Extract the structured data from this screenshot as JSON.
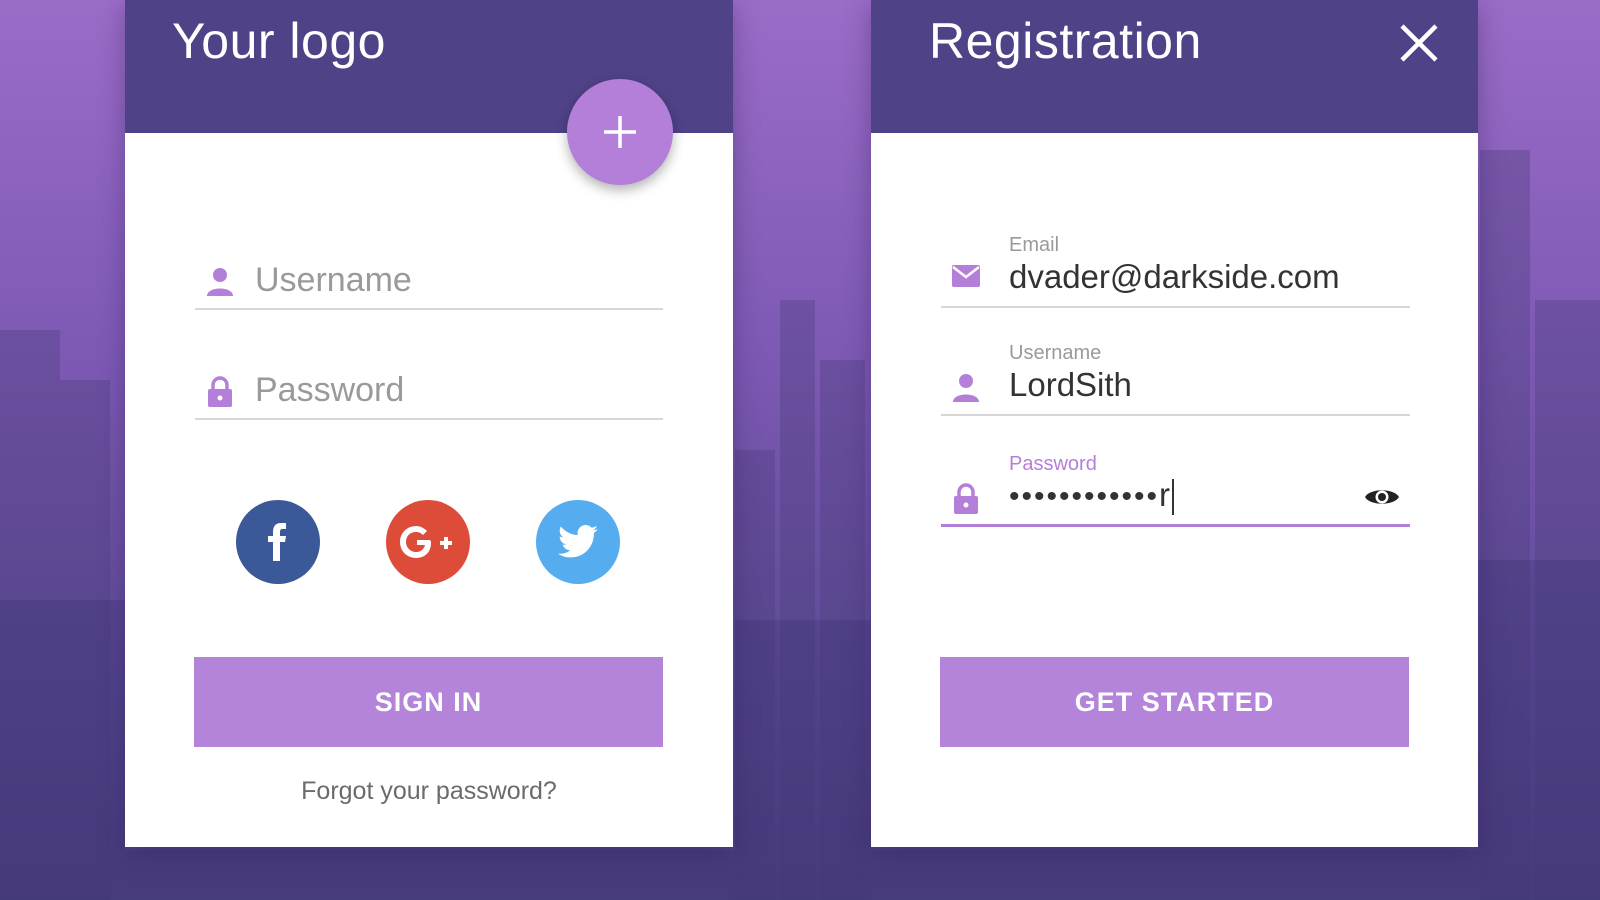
{
  "colors": {
    "header": "#4f4287",
    "accent": "#b47fd8",
    "facebook": "#3b5998",
    "google": "#dd4b39",
    "twitter": "#55acee"
  },
  "login_card": {
    "title": "Your logo",
    "fab_icon": "plus-icon",
    "username_placeholder": "Username",
    "password_placeholder": "Password",
    "social": [
      {
        "name": "facebook",
        "icon": "facebook-icon"
      },
      {
        "name": "google-plus",
        "icon": "google-plus-icon"
      },
      {
        "name": "twitter",
        "icon": "twitter-icon"
      }
    ],
    "sign_in_label": "SIGN IN",
    "forgot_label": "Forgot your password?"
  },
  "registration_card": {
    "title": "Registration",
    "close_icon": "close-icon",
    "email_label": "Email",
    "email_value": "dvader@darkside.com",
    "username_label": "Username",
    "username_value": "LordSith",
    "password_label": "Password",
    "password_masked": "••••••••••••",
    "password_last_char": "r",
    "submit_label": "GET STARTED"
  }
}
